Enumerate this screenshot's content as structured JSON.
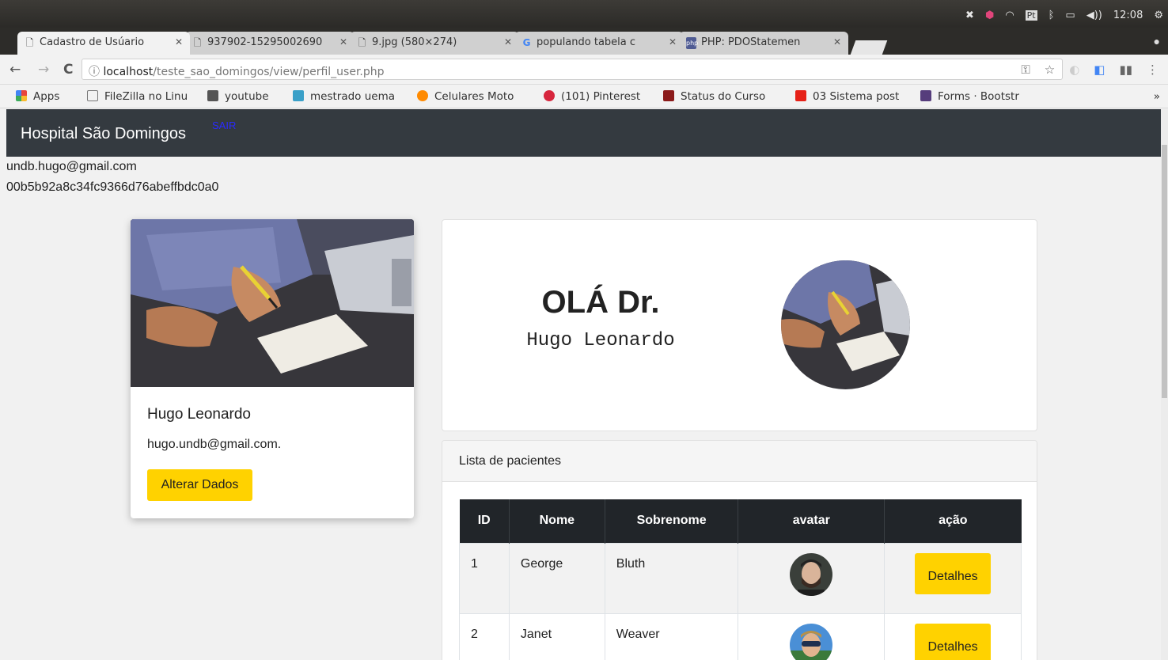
{
  "os": {
    "clock": "12:08"
  },
  "tabs": [
    {
      "title": "Cadastro de Usúario",
      "active": true
    },
    {
      "title": "937902-15295002690"
    },
    {
      "title": "9.jpg (580×274)"
    },
    {
      "title": "populando tabela c"
    },
    {
      "title": "PHP: PDOStatemen"
    }
  ],
  "address": {
    "host": "localhost",
    "path": "/teste_sao_domingos/view/perfil_user.php"
  },
  "bookmarks": [
    {
      "label": "Apps",
      "color": "#e8453c"
    },
    {
      "label": "FileZilla no Linu",
      "color": "#777777"
    },
    {
      "label": "youtube",
      "color": "#555555"
    },
    {
      "label": "mestrado uema",
      "color": "#3aa0c8"
    },
    {
      "label": "Celulares Moto",
      "color": "#ff8a00"
    },
    {
      "label": "(101) Pinterest",
      "color": "#d7263d"
    },
    {
      "label": "Status do Curso",
      "color": "#8b1a1a"
    },
    {
      "label": "03 Sistema post",
      "color": "#e62117"
    },
    {
      "label": "Forms · Bootstr",
      "color": "#563d7c"
    }
  ],
  "navbar": {
    "brand": "Hospital São Domingos",
    "logout": "SAIR"
  },
  "session": {
    "email": "undb.hugo@gmail.com",
    "hash": "00b5b92a8c34fc9366d76abeffbdc0a0"
  },
  "profile": {
    "name": "Hugo Leonardo",
    "email": "hugo.undb@gmail.com.",
    "edit_label": "Alterar Dados"
  },
  "greeting": {
    "title": "OLÁ Dr.",
    "name": "Hugo Leonardo"
  },
  "patients": {
    "header": "Lista de pacientes",
    "columns": [
      "ID",
      "Nome",
      "Sobrenome",
      "avatar",
      "ação"
    ],
    "rows": [
      {
        "id": "1",
        "nome": "George",
        "sobrenome": "Bluth",
        "action": "Detalhes"
      },
      {
        "id": "2",
        "nome": "Janet",
        "sobrenome": "Weaver",
        "action": "Detalhes"
      }
    ]
  }
}
